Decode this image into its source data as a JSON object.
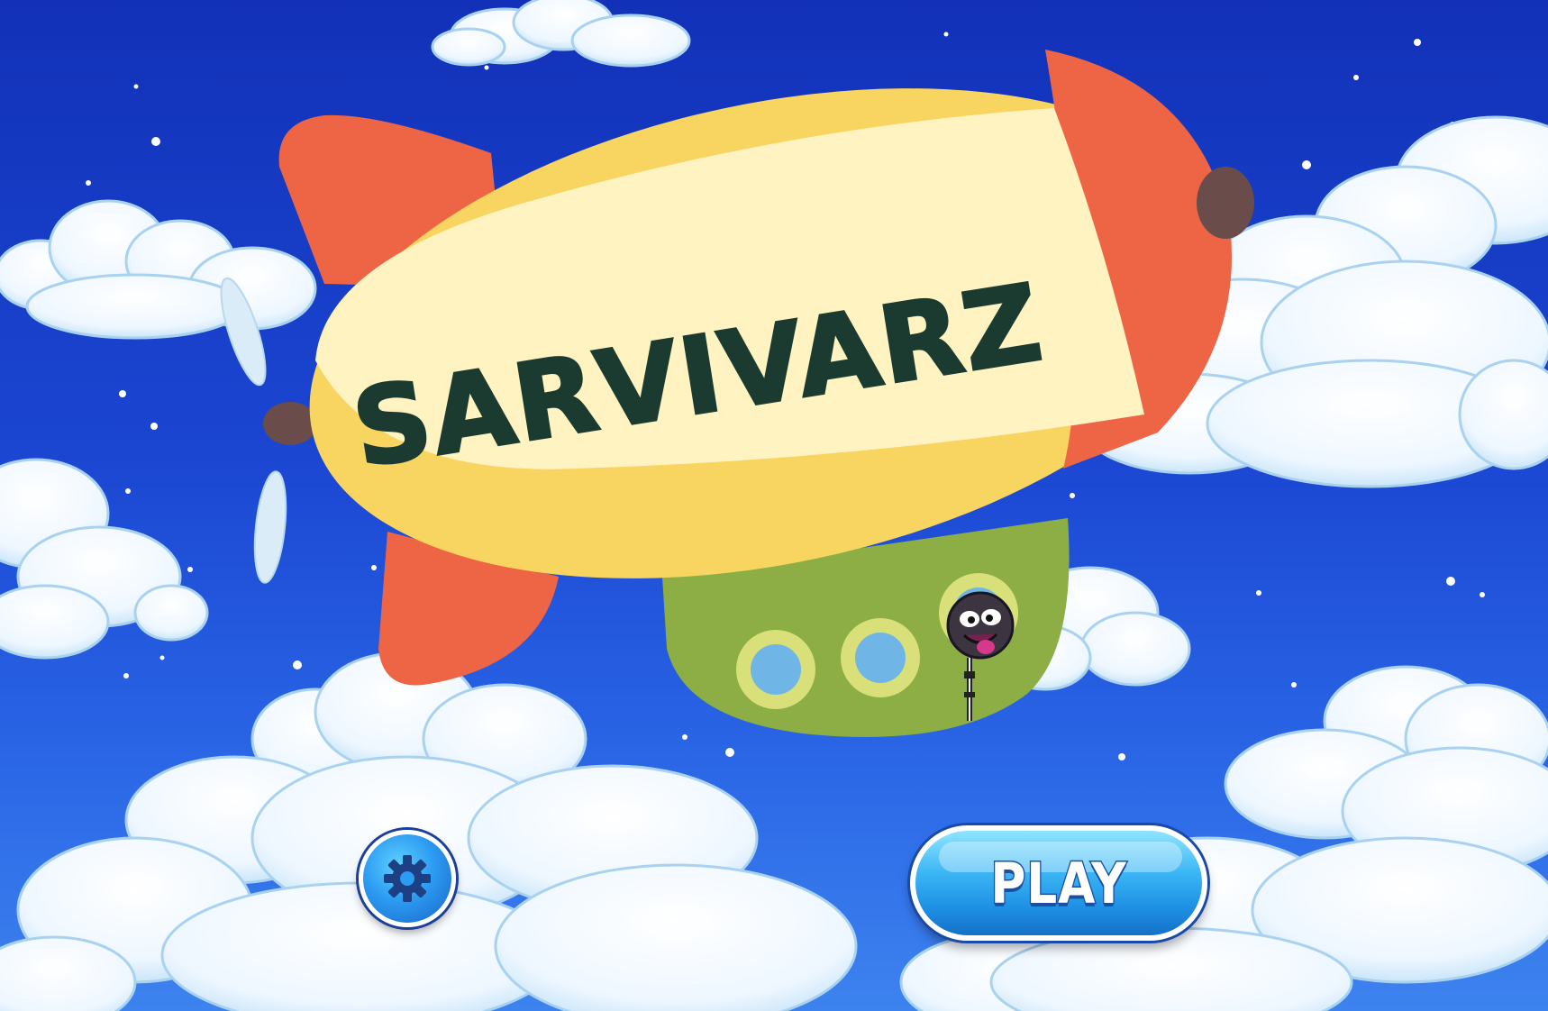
{
  "game": {
    "title": "SARVIVARZ"
  },
  "menu": {
    "play_label": "PLAY",
    "settings_icon": "gear-icon"
  },
  "colors": {
    "sky_top": "#1231b8",
    "sky_bottom": "#3d83ef",
    "balloon_yellow": "#f8d560",
    "balloon_cream": "#fff3c2",
    "balloon_red": "#ee6545",
    "gondola_green": "#8cae45",
    "title_ink": "#1b3a30",
    "button_blue": "#2c9cf2"
  }
}
